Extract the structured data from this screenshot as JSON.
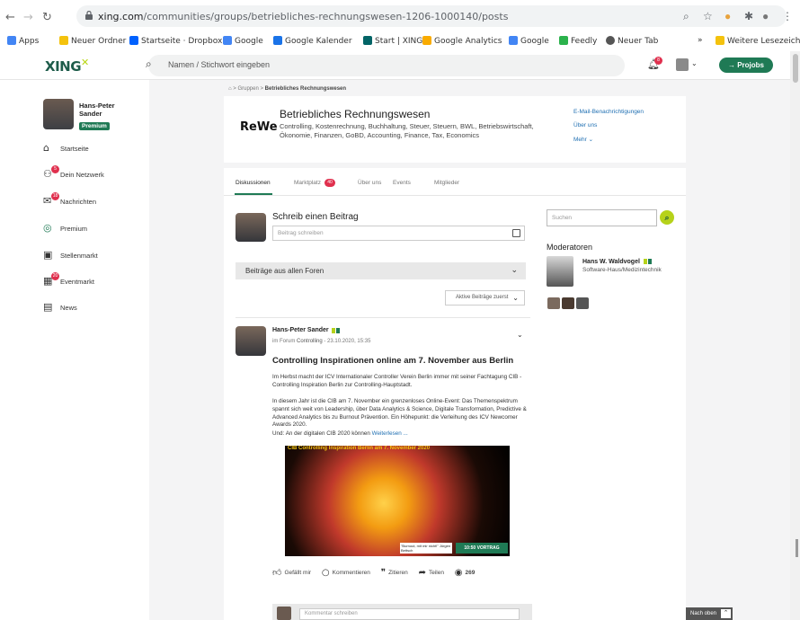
{
  "browser": {
    "url_domain": "xing.com",
    "url_path": "/communities/groups/betriebliches-rechnungswesen-1206-1000140/posts",
    "bookmarks": [
      {
        "label": "Apps",
        "color": "#4285f4"
      },
      {
        "label": "Neuer Ordner",
        "color": "#f4c20d"
      },
      {
        "label": "Startseite · Dropbox",
        "color": "#0061fe"
      },
      {
        "label": "Google",
        "color": "#4285f4"
      },
      {
        "label": "Google Kalender",
        "color": "#1a73e8"
      },
      {
        "label": "Start | XING",
        "color": "#026466"
      },
      {
        "label": "Google Analytics",
        "color": "#f9ab00"
      },
      {
        "label": "Google",
        "color": "#4285f4"
      },
      {
        "label": "Feedly",
        "color": "#2bb24c"
      },
      {
        "label": "Neuer Tab",
        "color": "#555555"
      }
    ],
    "bookmarks_overflow": "»",
    "other_bookmarks": "Weitere Lesezeichen"
  },
  "header": {
    "logo": "XING",
    "search_placeholder": "Namen / Stichwort eingeben",
    "bell_badge": "8",
    "projobs_label": "→ Projobs"
  },
  "sidebar": {
    "user_name": "Hans-Peter Sander",
    "premium_label": "Premium",
    "items": [
      {
        "label": "Startseite",
        "icon": "home-icon",
        "badge": ""
      },
      {
        "label": "Dein Netzwerk",
        "icon": "network-icon",
        "badge": "5"
      },
      {
        "label": "Nachrichten",
        "icon": "messages-icon",
        "badge": "18"
      },
      {
        "label": "Premium",
        "icon": "premium-icon",
        "badge": ""
      },
      {
        "label": "Stellenmarkt",
        "icon": "jobs-icon",
        "badge": ""
      },
      {
        "label": "Eventmarkt",
        "icon": "events-icon",
        "badge": "20"
      },
      {
        "label": "News",
        "icon": "news-icon",
        "badge": ""
      }
    ]
  },
  "breadcrumb": {
    "prefix": "Gruppen",
    "current": "Betriebliches Rechnungswesen"
  },
  "group": {
    "logo": "ReWe",
    "title": "Betriebliches Rechnungswesen",
    "description": "Controlling, Kostenrechnung, Buchhaltung, Steuer, Steuern, BWL, Betriebswirtschaft, Ökonomie, Finanzen, GoBD, Accounting, Finance, Tax, Economics",
    "links": [
      "E-Mail-Benachrichtigungen",
      "Über uns",
      "Mehr ⌄"
    ]
  },
  "tabs": [
    {
      "label": "Diskussionen",
      "badge": ""
    },
    {
      "label": "Marktplatz",
      "badge": "40"
    },
    {
      "label": "Über uns",
      "badge": ""
    },
    {
      "label": "Events",
      "badge": ""
    },
    {
      "label": "Mitglieder",
      "badge": ""
    }
  ],
  "write": {
    "title": "Schreib einen Beitrag",
    "placeholder": "Beitrag schreiben"
  },
  "filter": {
    "forum": "Beiträge aus allen Foren",
    "sort": "Aktive Beiträge zuerst"
  },
  "right": {
    "search_placeholder": "Suchen",
    "moderators_heading": "Moderatoren",
    "moderator_name": "Hans W. Waldvogel",
    "moderator_company": "Software-Haus/Medizintechnik"
  },
  "post": {
    "author": "Hans-Peter Sander",
    "forum_prefix": "im Forum",
    "forum": "Controlling",
    "date": "23.10.2020, 15:35",
    "title": "Controlling Inspirationen online am 7. November aus Berlin",
    "para1": "Im Herbst macht der ICV Internationaler Controller Verein Berlin immer mit seiner Fachtagung CIB - Controlling Inspiration Berlin zur Controlling-Hauptstadt.",
    "para2": "In diesem Jahr ist die CIB am 7. November ein grenzenloses Online-Event: Das Themenspektrum spannt sich weit von Leadership, über Data Analytics & Science, Digitale Transformation, Predictive & Advanced Analytics bis zu Burnout Prävention. Ein Höhepunkt: die Verleihung des ICV Newcomer Awards 2020.",
    "para3": "Und: An der digitalen CIB 2020 können",
    "read_more": "Weiterlesen ...",
    "image_caption": "CIB Controlling Inspiration Berlin am 7. November 2020",
    "image_quote": "\"Burnout, mit mir nicht!\" Jürgen Bettsch",
    "image_tag": "10:50 VORTRAG",
    "actions": {
      "like": "Gefällt mir",
      "comment": "Kommentieren",
      "quote": "Zitieren",
      "share": "Teilen",
      "views": "269"
    },
    "comment_placeholder": "Kommentar schreiben"
  },
  "back_to_top": "Nach oben"
}
